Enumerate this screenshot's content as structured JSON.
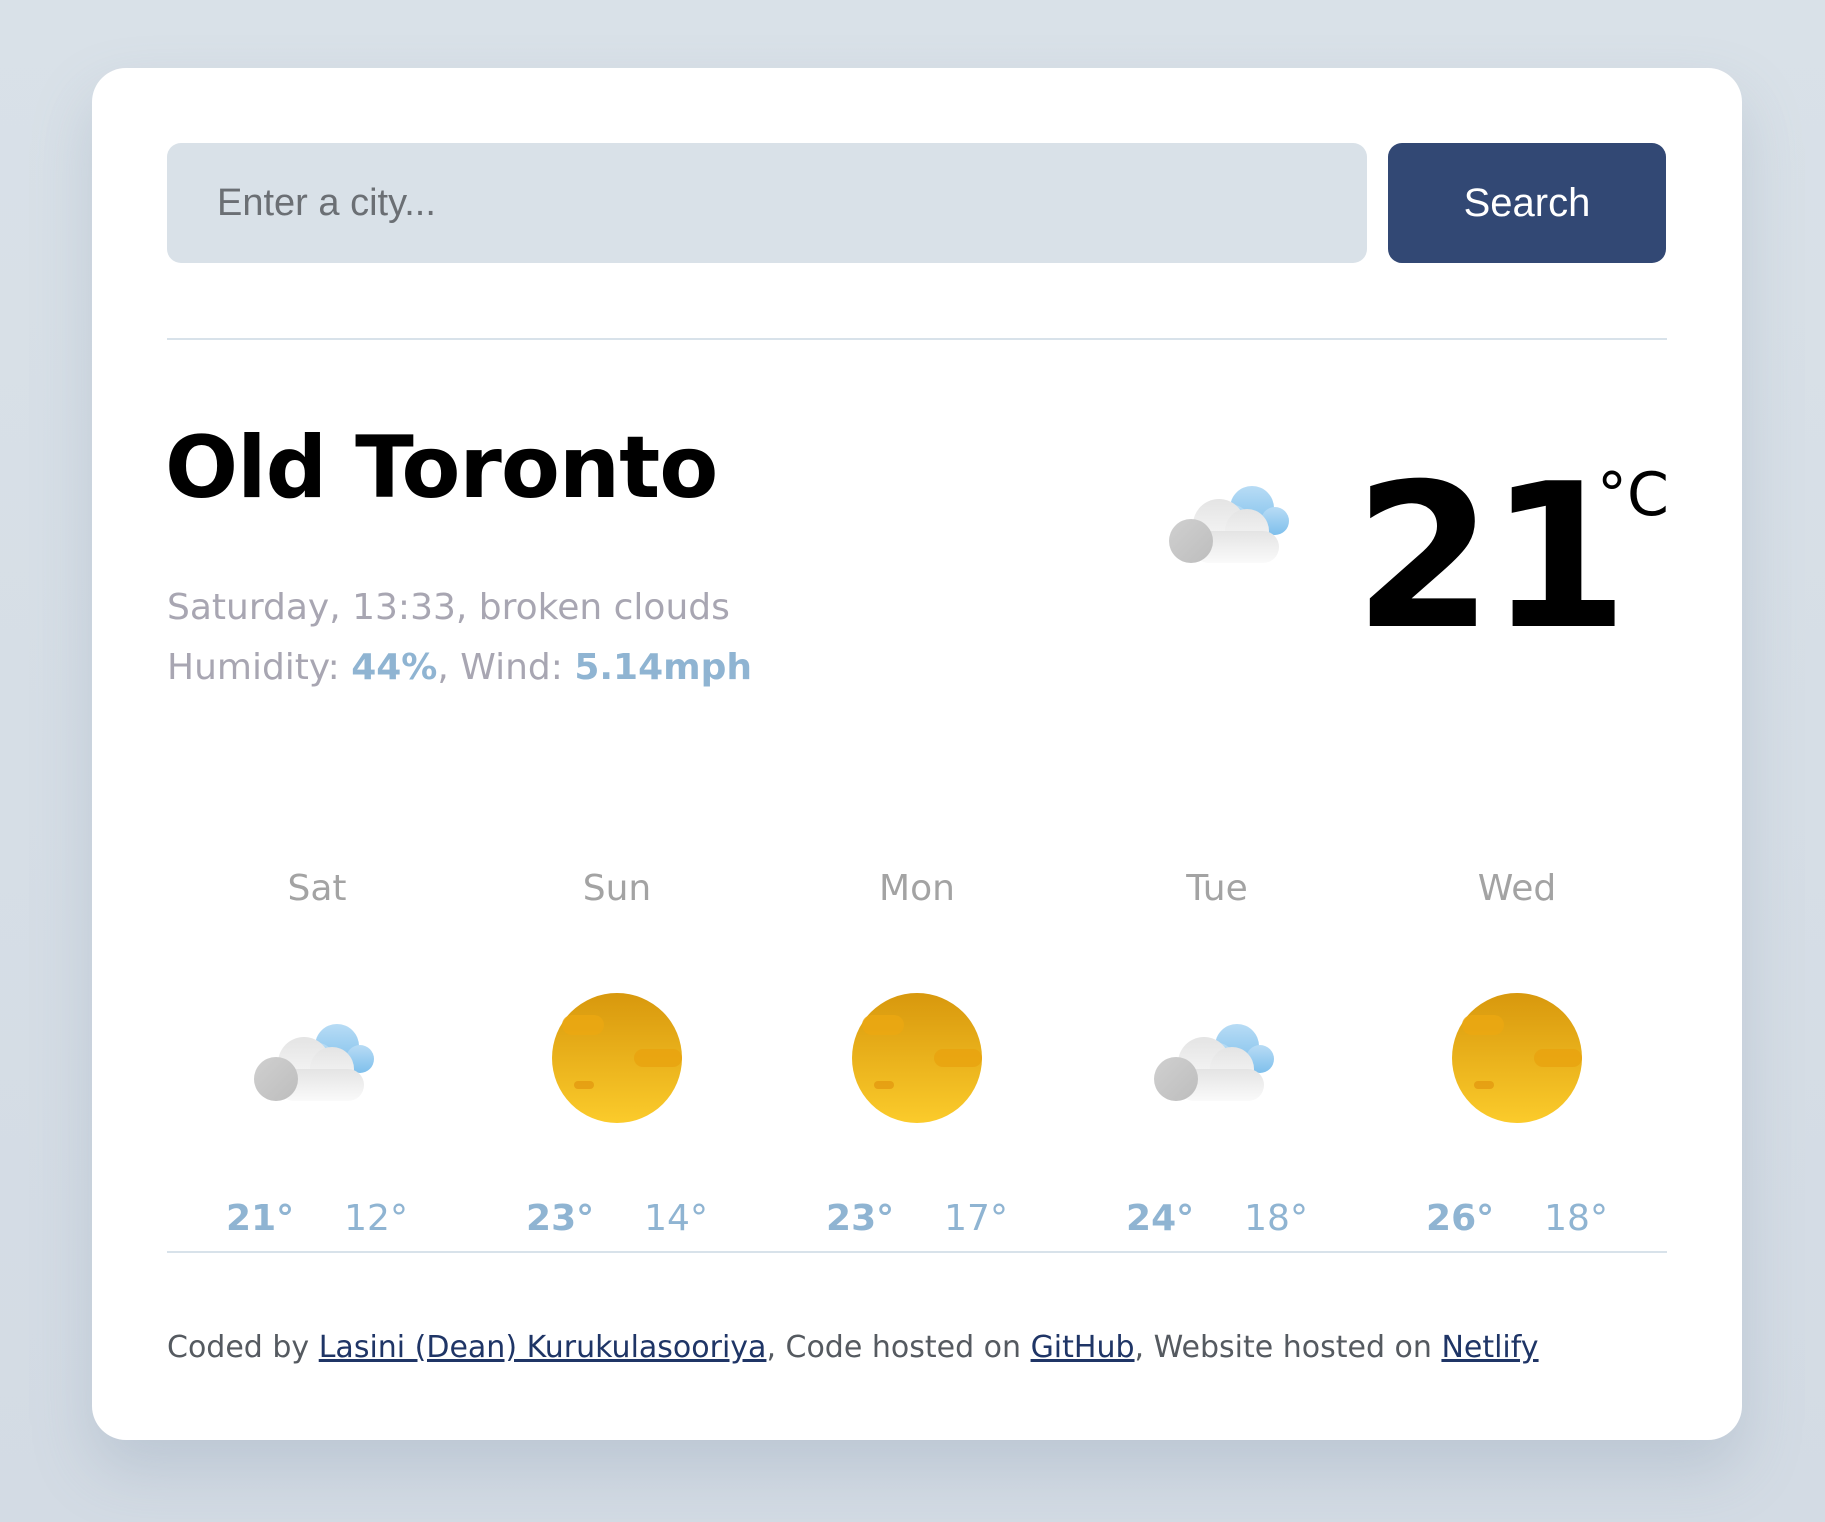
{
  "search": {
    "placeholder": "Enter a city...",
    "button_label": "Search"
  },
  "current": {
    "city": "Old Toronto",
    "day": "Saturday",
    "time": "13:33",
    "description": "broken clouds",
    "humidity_label": "Humidity:",
    "humidity": "44%",
    "wind_label": "Wind:",
    "wind": "5.14mph",
    "temperature": "21",
    "unit": "°C",
    "icon": "broken-clouds-icon"
  },
  "forecast": [
    {
      "day": "Sat",
      "max": "21°",
      "min": "12°",
      "icon": "broken-clouds-icon"
    },
    {
      "day": "Sun",
      "max": "23°",
      "min": "14°",
      "icon": "sun-icon"
    },
    {
      "day": "Mon",
      "max": "23°",
      "min": "17°",
      "icon": "sun-icon"
    },
    {
      "day": "Tue",
      "max": "24°",
      "min": "18°",
      "icon": "broken-clouds-icon"
    },
    {
      "day": "Wed",
      "max": "26°",
      "min": "18°",
      "icon": "sun-icon"
    }
  ],
  "footer": {
    "prefix": "Coded by ",
    "author": "Lasini (Dean) Kurukulasooriya",
    "mid1": ", Code hosted on ",
    "github": "GitHub",
    "mid2": ", Website hosted on ",
    "netlify": "Netlify"
  },
  "colors": {
    "page_background": "#d9e1e8",
    "card_background": "#ffffff",
    "input_background": "#d9e1e8",
    "button_background": "#324874",
    "accent_blue": "#8fb4d2",
    "muted_text": "#a8a6b2",
    "link": "#1f3566"
  }
}
